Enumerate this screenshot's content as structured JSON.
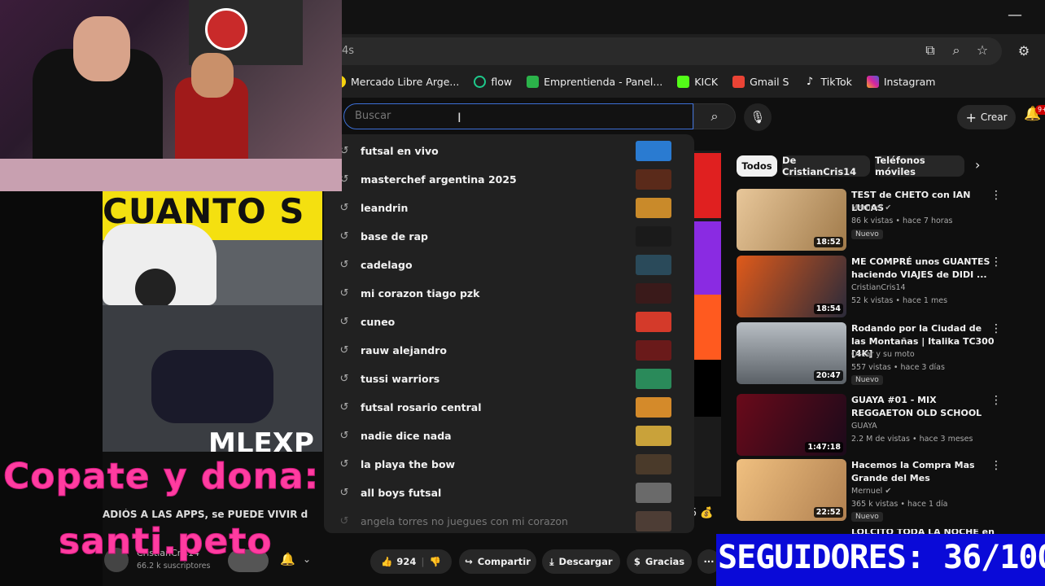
{
  "browser": {
    "url_fragment": "4s",
    "minimize_glyph": "—",
    "bookmarks": [
      {
        "label": "Mercado Libre Arge...",
        "color": "#f5d30e"
      },
      {
        "label": "flow",
        "color": "#1ec98b"
      },
      {
        "label": "Emprentienda - Panel...",
        "color": "#2bb34a"
      },
      {
        "label": "KICK",
        "color": "#53fc18"
      },
      {
        "label": "Gmail S",
        "color": "#ea4335"
      },
      {
        "label": "TikTok",
        "color": "#ffffff"
      },
      {
        "label": "Instagram",
        "color": "#d6249f"
      }
    ]
  },
  "youtube": {
    "search_placeholder": "Buscar",
    "create_label": "Crear",
    "notification_count": "9+",
    "suggestions": [
      {
        "text": "futsal en vivo",
        "thumb": "#2a7bd1"
      },
      {
        "text": "masterchef argentina 2025",
        "thumb": "#5a2a1a"
      },
      {
        "text": "leandrin",
        "thumb": "#c98a2a"
      },
      {
        "text": "base de rap",
        "thumb": "#1a1a1a"
      },
      {
        "text": "cadelago",
        "thumb": "#2a4a5a"
      },
      {
        "text": "mi corazon tiago pzk",
        "thumb": "#3a1a1a"
      },
      {
        "text": "cuneo",
        "thumb": "#d43a2a"
      },
      {
        "text": "rauw alejandro",
        "thumb": "#6a1a1a"
      },
      {
        "text": "tussi warriors",
        "thumb": "#2a8a5a"
      },
      {
        "text": "futsal rosario central",
        "thumb": "#d48a2a"
      },
      {
        "text": "nadie dice nada",
        "thumb": "#c9a23a"
      },
      {
        "text": "la playa the bow",
        "thumb": "#4a3a2a"
      },
      {
        "text": "all boys futsal",
        "thumb": "#6a6a6a"
      },
      {
        "text": "angela torres no juegues con mi corazon",
        "thumb": "#7a5a4a"
      }
    ],
    "chips": [
      {
        "label": "Todos",
        "active": true
      },
      {
        "label": "De CristianCris14",
        "active": false
      },
      {
        "label": "Teléfonos móviles",
        "active": false
      }
    ],
    "recommendations": [
      {
        "title": "TEST de CHETO con IAN LUCAS",
        "channel": "Mernuel ✔",
        "meta": "86 k vistas • hace 7 horas",
        "duration": "18:52",
        "badge": "Nuevo",
        "thumb": "#c9a77a"
      },
      {
        "title": "ME COMPRÉ unos GUANTES haciendo VIAJES de DIDI ...",
        "channel": "CristianCris14",
        "meta": "52 k vistas • hace 1 mes",
        "duration": "18:54",
        "badge": "",
        "thumb": "#d46a1a"
      },
      {
        "title": "Rodando por la Ciudad de las Montañas | Italika TC300 [4K]",
        "channel": "Oscar y su moto",
        "meta": "557 vistas • hace 3 días",
        "duration": "20:47",
        "badge": "Nuevo",
        "thumb": "#8a8f94"
      },
      {
        "title": "GUAYA #01 - MIX REGGAETON OLD SCHOOL",
        "channel": "GUAYA",
        "meta": "2.2 M de vistas • hace 3 meses",
        "duration": "1:47:18",
        "badge": "",
        "thumb": "#7a1a2a"
      },
      {
        "title": "Hacemos la Compra Mas Grande del Mes",
        "channel": "Mernuel ✔",
        "meta": "365 k vistas • hace 1 día",
        "duration": "22:52",
        "badge": "Nuevo",
        "thumb": "#e0b070"
      },
      {
        "title": "LOLCITO TODA LA NOCHE en",
        "channel": "",
        "meta": "",
        "duration": "",
        "badge": "",
        "thumb": "#222222"
      }
    ],
    "video_count_partial": "5 💰",
    "actions": {
      "likes": "924",
      "share": "Compartir",
      "download": "Descargar",
      "thanks": "Gracias",
      "more": "···"
    }
  },
  "overlay": {
    "donate_line1": "Copate y dona:",
    "donate_line2": "santi.peto",
    "caption_left": "ADIÓS A LAS APPS, se PUEDE VIVIR d",
    "channel_left": "CristianCris14",
    "subs_left": "66.2 k suscriptores",
    "video_left_top_text": "CUANTO S",
    "video_left_watermark": "MLEXP",
    "followers": "SEGUIDORES: 36/100"
  }
}
